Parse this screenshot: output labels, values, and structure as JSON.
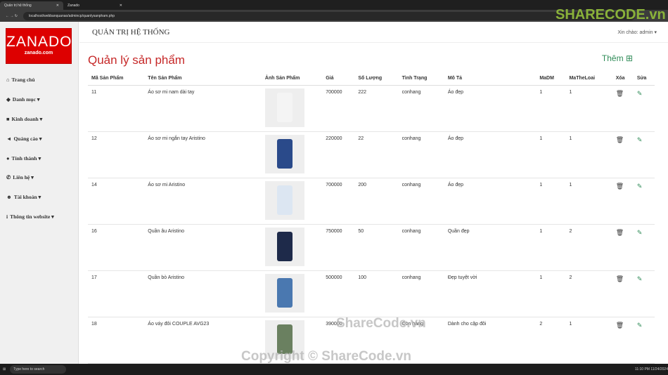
{
  "browser": {
    "tabs": [
      "Quản trị hệ thống",
      "Zanado"
    ],
    "url": "localhost/webbanquanao/admincp/quanlysanpham.php"
  },
  "logo": {
    "brand": "ZANADO",
    "domain": "zanado.com",
    "color": "#dd0000"
  },
  "sidebar": {
    "items": [
      {
        "label": "Trang chủ",
        "icon": "home-icon"
      },
      {
        "label": "Danh mục ▾",
        "icon": "tags-icon"
      },
      {
        "label": "Kinh doanh ▾",
        "icon": "briefcase-icon"
      },
      {
        "label": "Quảng cáo ▾",
        "icon": "bullhorn-icon"
      },
      {
        "label": "Tỉnh thành ▾",
        "icon": "globe-icon"
      },
      {
        "label": "Liên hệ ▾",
        "icon": "phone-icon"
      },
      {
        "label": "Tài khoản ▾",
        "icon": "users-icon"
      },
      {
        "label": "Thông tin website ▾",
        "icon": "info-icon"
      }
    ]
  },
  "header": {
    "title": "QUẢN TRỊ HỆ THỐNG",
    "greeting": "Xin chào: admin ▾"
  },
  "page": {
    "title": "Quản lý sản phẩm",
    "add_label": "Thêm"
  },
  "table": {
    "headers": [
      "Mã Sản Phẩm",
      "Tên Sản Phẩm",
      "Ảnh Sản Phẩm",
      "Giá",
      "Số Lượng",
      "Tình Trạng",
      "Mô Tả",
      "MaDM",
      "MaTheLoai",
      "Xóa",
      "Sửa"
    ],
    "rows": [
      [
        "11",
        "Áo sơ mi nam dài tay",
        "700000",
        "222",
        "conhang",
        "Áo đẹp",
        "1",
        "1"
      ],
      [
        "12",
        "Áo sơ mi ngắn tay Aristino",
        "220000",
        "22",
        "conhang",
        "Áo đẹp",
        "1",
        "1"
      ],
      [
        "14",
        "Áo sơ mi Aristino",
        "700000",
        "200",
        "conhang",
        "Áo đẹp",
        "1",
        "1"
      ],
      [
        "16",
        "Quần âu Aristino",
        "750000",
        "50",
        "conhang",
        "Quần đẹp",
        "1",
        "2"
      ],
      [
        "17",
        "Quần bò Aristino",
        "500000",
        "100",
        "conhang",
        "Đẹp tuyệt vời",
        "1",
        "2"
      ],
      [
        "18",
        "Áo váy đôi COUPLE AVG23",
        "390000",
        "",
        "Còn hàng",
        "Dành cho cặp đôi",
        "2",
        "1"
      ]
    ]
  },
  "taskbar": {
    "search": "Type here to search",
    "time": "11:10 PM",
    "date": "11/24/2024"
  },
  "watermark": {
    "logo": "SHARECODE.vn",
    "center": "ShareCode.vn",
    "bottom": "Copyright © ShareCode.vn"
  }
}
